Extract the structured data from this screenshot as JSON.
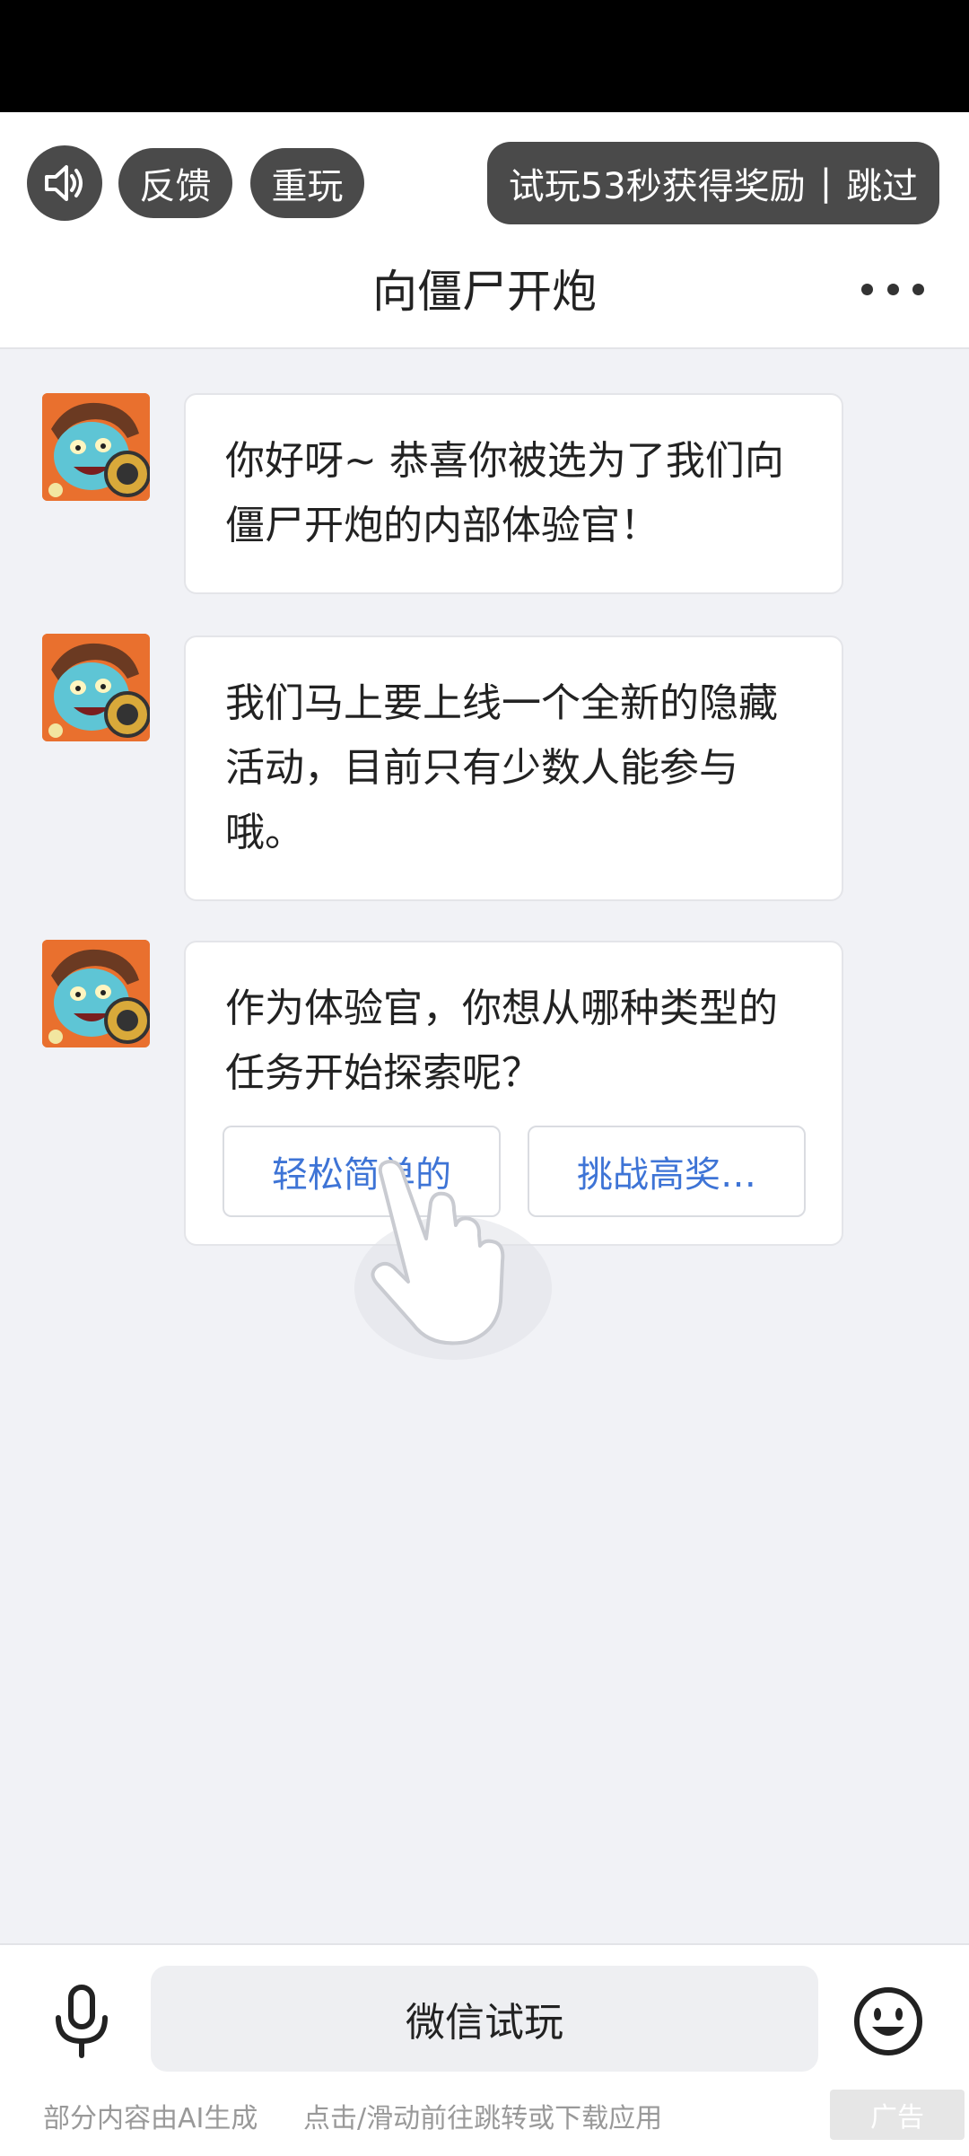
{
  "topbar": {
    "sound_icon": "speaker-icon",
    "feedback_label": "反馈",
    "replay_label": "重玩",
    "trial_text": "试玩53秒获得奖励",
    "trial_sep": "|",
    "skip_label": "跳过",
    "title": "向僵尸开炮",
    "more_icon": "more-icon"
  },
  "chat": {
    "messages": [
      {
        "text": "你好呀~ 恭喜你被选为了我们向僵尸开炮的内部体验官！"
      },
      {
        "text": "我们马上要上线一个全新的隐藏活动，目前只有少数人能参与哦。"
      },
      {
        "text": "作为体验官，你想从哪种类型的任务开始探索呢？"
      }
    ],
    "options": [
      "轻松简单的",
      "挑战高奖…"
    ]
  },
  "bottom": {
    "mic_icon": "microphone-icon",
    "wechat_label": "微信试玩",
    "emoji_icon": "smiley-icon",
    "ai_note": "部分内容由AI生成",
    "tap_note": "点击/滑动前往跳转或下载应用",
    "ad_label": "广告"
  }
}
